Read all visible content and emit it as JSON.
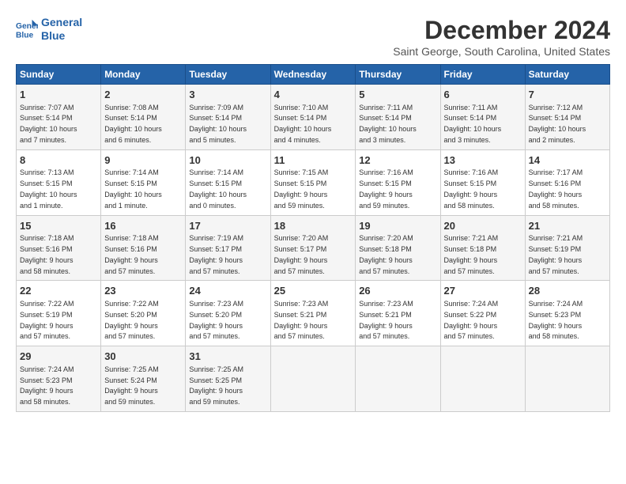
{
  "logo": {
    "line1": "General",
    "line2": "Blue"
  },
  "title": "December 2024",
  "subtitle": "Saint George, South Carolina, United States",
  "days_of_week": [
    "Sunday",
    "Monday",
    "Tuesday",
    "Wednesday",
    "Thursday",
    "Friday",
    "Saturday"
  ],
  "weeks": [
    [
      {
        "day": "1",
        "info": "Sunrise: 7:07 AM\nSunset: 5:14 PM\nDaylight: 10 hours\nand 7 minutes."
      },
      {
        "day": "2",
        "info": "Sunrise: 7:08 AM\nSunset: 5:14 PM\nDaylight: 10 hours\nand 6 minutes."
      },
      {
        "day": "3",
        "info": "Sunrise: 7:09 AM\nSunset: 5:14 PM\nDaylight: 10 hours\nand 5 minutes."
      },
      {
        "day": "4",
        "info": "Sunrise: 7:10 AM\nSunset: 5:14 PM\nDaylight: 10 hours\nand 4 minutes."
      },
      {
        "day": "5",
        "info": "Sunrise: 7:11 AM\nSunset: 5:14 PM\nDaylight: 10 hours\nand 3 minutes."
      },
      {
        "day": "6",
        "info": "Sunrise: 7:11 AM\nSunset: 5:14 PM\nDaylight: 10 hours\nand 3 minutes."
      },
      {
        "day": "7",
        "info": "Sunrise: 7:12 AM\nSunset: 5:14 PM\nDaylight: 10 hours\nand 2 minutes."
      }
    ],
    [
      {
        "day": "8",
        "info": "Sunrise: 7:13 AM\nSunset: 5:15 PM\nDaylight: 10 hours\nand 1 minute."
      },
      {
        "day": "9",
        "info": "Sunrise: 7:14 AM\nSunset: 5:15 PM\nDaylight: 10 hours\nand 1 minute."
      },
      {
        "day": "10",
        "info": "Sunrise: 7:14 AM\nSunset: 5:15 PM\nDaylight: 10 hours\nand 0 minutes."
      },
      {
        "day": "11",
        "info": "Sunrise: 7:15 AM\nSunset: 5:15 PM\nDaylight: 9 hours\nand 59 minutes."
      },
      {
        "day": "12",
        "info": "Sunrise: 7:16 AM\nSunset: 5:15 PM\nDaylight: 9 hours\nand 59 minutes."
      },
      {
        "day": "13",
        "info": "Sunrise: 7:16 AM\nSunset: 5:15 PM\nDaylight: 9 hours\nand 58 minutes."
      },
      {
        "day": "14",
        "info": "Sunrise: 7:17 AM\nSunset: 5:16 PM\nDaylight: 9 hours\nand 58 minutes."
      }
    ],
    [
      {
        "day": "15",
        "info": "Sunrise: 7:18 AM\nSunset: 5:16 PM\nDaylight: 9 hours\nand 58 minutes."
      },
      {
        "day": "16",
        "info": "Sunrise: 7:18 AM\nSunset: 5:16 PM\nDaylight: 9 hours\nand 57 minutes."
      },
      {
        "day": "17",
        "info": "Sunrise: 7:19 AM\nSunset: 5:17 PM\nDaylight: 9 hours\nand 57 minutes."
      },
      {
        "day": "18",
        "info": "Sunrise: 7:20 AM\nSunset: 5:17 PM\nDaylight: 9 hours\nand 57 minutes."
      },
      {
        "day": "19",
        "info": "Sunrise: 7:20 AM\nSunset: 5:18 PM\nDaylight: 9 hours\nand 57 minutes."
      },
      {
        "day": "20",
        "info": "Sunrise: 7:21 AM\nSunset: 5:18 PM\nDaylight: 9 hours\nand 57 minutes."
      },
      {
        "day": "21",
        "info": "Sunrise: 7:21 AM\nSunset: 5:19 PM\nDaylight: 9 hours\nand 57 minutes."
      }
    ],
    [
      {
        "day": "22",
        "info": "Sunrise: 7:22 AM\nSunset: 5:19 PM\nDaylight: 9 hours\nand 57 minutes."
      },
      {
        "day": "23",
        "info": "Sunrise: 7:22 AM\nSunset: 5:20 PM\nDaylight: 9 hours\nand 57 minutes."
      },
      {
        "day": "24",
        "info": "Sunrise: 7:23 AM\nSunset: 5:20 PM\nDaylight: 9 hours\nand 57 minutes."
      },
      {
        "day": "25",
        "info": "Sunrise: 7:23 AM\nSunset: 5:21 PM\nDaylight: 9 hours\nand 57 minutes."
      },
      {
        "day": "26",
        "info": "Sunrise: 7:23 AM\nSunset: 5:21 PM\nDaylight: 9 hours\nand 57 minutes."
      },
      {
        "day": "27",
        "info": "Sunrise: 7:24 AM\nSunset: 5:22 PM\nDaylight: 9 hours\nand 57 minutes."
      },
      {
        "day": "28",
        "info": "Sunrise: 7:24 AM\nSunset: 5:23 PM\nDaylight: 9 hours\nand 58 minutes."
      }
    ],
    [
      {
        "day": "29",
        "info": "Sunrise: 7:24 AM\nSunset: 5:23 PM\nDaylight: 9 hours\nand 58 minutes."
      },
      {
        "day": "30",
        "info": "Sunrise: 7:25 AM\nSunset: 5:24 PM\nDaylight: 9 hours\nand 59 minutes."
      },
      {
        "day": "31",
        "info": "Sunrise: 7:25 AM\nSunset: 5:25 PM\nDaylight: 9 hours\nand 59 minutes."
      },
      null,
      null,
      null,
      null
    ]
  ]
}
